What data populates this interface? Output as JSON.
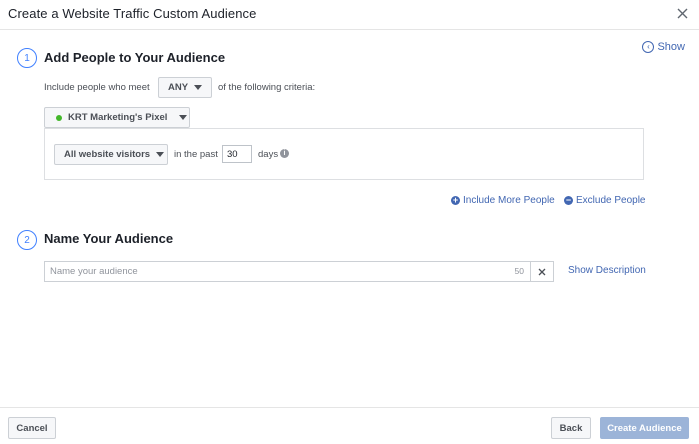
{
  "dialog": {
    "title": "Create a Website Traffic Custom Audience"
  },
  "show_toggle": {
    "label": "Show"
  },
  "step1": {
    "number": "1",
    "title": "Add People to Your Audience",
    "include_prefix": "Include people who meet",
    "match_value": "ANY",
    "include_suffix": "of the following criteria:",
    "pixel": {
      "name": "KRT Marketing's Pixel",
      "status_color": "#42b72a"
    },
    "rule": {
      "visitor_type": "All website visitors",
      "in_the_past": "in the past",
      "days_value": "30",
      "days_label": "days"
    },
    "include_more": "Include More People",
    "exclude": "Exclude People"
  },
  "step2": {
    "number": "2",
    "title": "Name Your Audience",
    "name_placeholder": "Name your audience",
    "name_value": "",
    "char_limit": "50",
    "show_description": "Show Description"
  },
  "footer": {
    "cancel": "Cancel",
    "back": "Back",
    "create": "Create Audience"
  },
  "colors": {
    "accent": "#4267b2",
    "step_circle": "#4080ff",
    "primary_disabled": "#9cb4d8"
  }
}
